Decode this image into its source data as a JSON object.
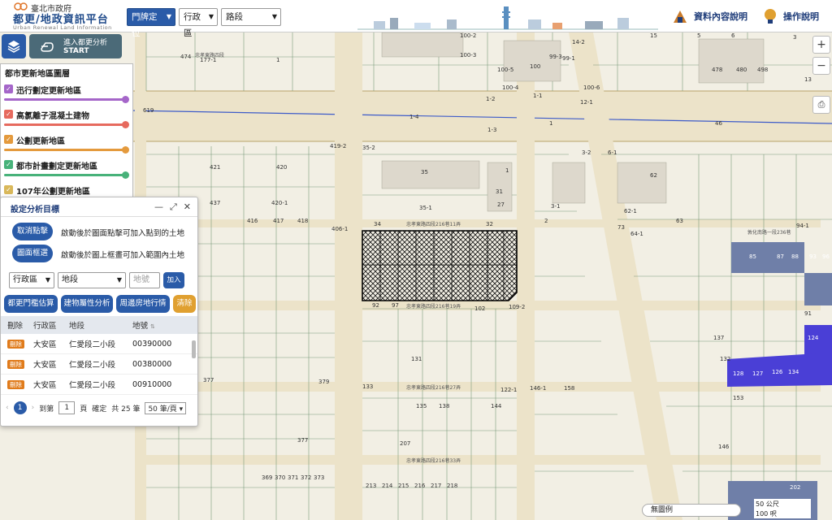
{
  "header": {
    "gov_name": "臺北市政府",
    "title": "都更/地政資訊平台",
    "subtitle": "Urban Renewal Land Information",
    "locate_mode": "門牌定位",
    "district_placeholder": "行政區",
    "road_placeholder": "路段",
    "data_info_label": "資料內容說明",
    "help_label": "操作說明"
  },
  "toolbar": {
    "analysis_line1": "進入都更分析",
    "analysis_line2": "START"
  },
  "layers": {
    "title": "都市更新地區圖層",
    "items": [
      {
        "label": "迅行劃定更新地區",
        "color": "#a566c9"
      },
      {
        "label": "高氯離子混凝土建物",
        "color": "#e66a5e"
      },
      {
        "label": "公劃更新地區",
        "color": "#e49a3d"
      },
      {
        "label": "都市計畫劃定更新地區",
        "color": "#48b27a"
      },
      {
        "label": "107年公劃更新地區",
        "color": "#d9b85a"
      }
    ]
  },
  "dialog": {
    "title": "設定分析目標",
    "cancel_click_label": "取消點擊",
    "cancel_click_desc": "啟動後於圖面點擊可加入點到的土地",
    "box_select_label": "圖面框選",
    "box_select_desc": "啟動後於圖上框畫可加入範圍內土地",
    "district_placeholder": "行政區",
    "section_placeholder": "地段",
    "lot_placeholder": "地號",
    "add_label": "加入",
    "actions": [
      "都更門檻估算",
      "建物屬性分析",
      "周邊房地行情",
      "清除"
    ],
    "table": {
      "headers": [
        "刪除",
        "行政區",
        "地段",
        "地號"
      ],
      "rows": [
        {
          "del": "刪除",
          "district": "大安區",
          "section": "仁愛段二小段",
          "lot": "00390000"
        },
        {
          "del": "刪除",
          "district": "大安區",
          "section": "仁愛段二小段",
          "lot": "00380000"
        },
        {
          "del": "刪除",
          "district": "大安區",
          "section": "仁愛段二小段",
          "lot": "00910000"
        }
      ]
    },
    "pager": {
      "current": "1",
      "goto_label": "到第",
      "page_value": "1",
      "page_unit": "頁",
      "confirm": "確定",
      "total": "共 25 筆",
      "per_page": "50 筆/頁"
    }
  },
  "map": {
    "legend_label": "無圖例",
    "scale_1": "50 公尺",
    "scale_2": "100 呎",
    "parcel_labels": [
      "474",
      "177-1",
      "1",
      "100-2",
      "100-3",
      "99-3",
      "99-1",
      "14-2",
      "15",
      "5",
      "6",
      "3",
      "478",
      "480",
      "498",
      "13",
      "100",
      "100-5",
      "100-4",
      "100-6",
      "1-2",
      "1-1",
      "12-1",
      "619",
      "1-4",
      "1-3",
      "1",
      "46",
      "419-2",
      "35-2",
      "3-2",
      "6-1",
      "421",
      "420",
      "35",
      "1",
      "62",
      "437",
      "420-1",
      "35-1",
      "31",
      "27",
      "3-1",
      "62-1",
      "416",
      "417",
      "418",
      "34",
      "32",
      "2",
      "63",
      "73",
      "64-1",
      "94-1",
      "406-1",
      "85",
      "87",
      "88",
      "93",
      "96",
      "92",
      "97",
      "102",
      "109-2",
      "91",
      "137",
      "124",
      "132",
      "133",
      "122-1",
      "146-1",
      "158",
      "153",
      "131",
      "128",
      "127",
      "126",
      "134",
      "135",
      "138",
      "144",
      "207",
      "146",
      "202",
      "377",
      "369",
      "370",
      "371",
      "372",
      "373",
      "379",
      "377",
      "213",
      "214",
      "215",
      "216",
      "217",
      "218"
    ],
    "road_labels": [
      "忠孝東路四段216巷11弄",
      "忠孝東路四段216巷19弄",
      "忠孝東路四段216巷27弄",
      "忠孝東路四段216巷33弄",
      "敦化南路一段236巷",
      "忠孝東路四段"
    ]
  }
}
